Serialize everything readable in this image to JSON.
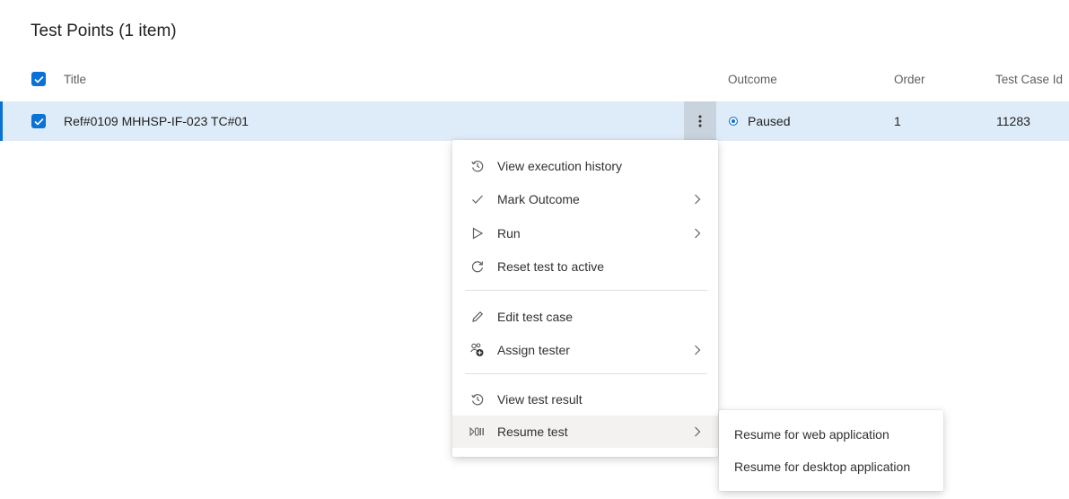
{
  "page_title": "Test Points (1 item)",
  "table": {
    "columns": {
      "title": "Title",
      "outcome": "Outcome",
      "order": "Order",
      "test_case_id": "Test Case Id"
    },
    "rows": [
      {
        "title": "Ref#0109 MHHSP-IF-023 TC#01",
        "outcome": "Paused",
        "order": "1",
        "test_case_id": "11283"
      }
    ]
  },
  "context_menu": {
    "items": [
      {
        "label": "View execution history",
        "icon": "history-icon",
        "has_submenu": false
      },
      {
        "label": "Mark Outcome",
        "icon": "checkmark-icon",
        "has_submenu": true
      },
      {
        "label": "Run",
        "icon": "play-icon",
        "has_submenu": true
      },
      {
        "label": "Reset test to active",
        "icon": "reset-icon",
        "has_submenu": false
      },
      {
        "label": "Edit test case",
        "icon": "pencil-icon",
        "has_submenu": false
      },
      {
        "label": "Assign tester",
        "icon": "assign-user-icon",
        "has_submenu": true
      },
      {
        "label": "View test result",
        "icon": "history-icon",
        "has_submenu": false
      },
      {
        "label": "Resume test",
        "icon": "resume-icon",
        "has_submenu": true
      }
    ]
  },
  "resume_submenu": {
    "items": [
      {
        "label": "Resume for web application"
      },
      {
        "label": "Resume for desktop application"
      }
    ]
  },
  "colors": {
    "accent": "#0a72d6",
    "selected_row": "#deecf9",
    "hover_item": "#f3f2f1"
  }
}
